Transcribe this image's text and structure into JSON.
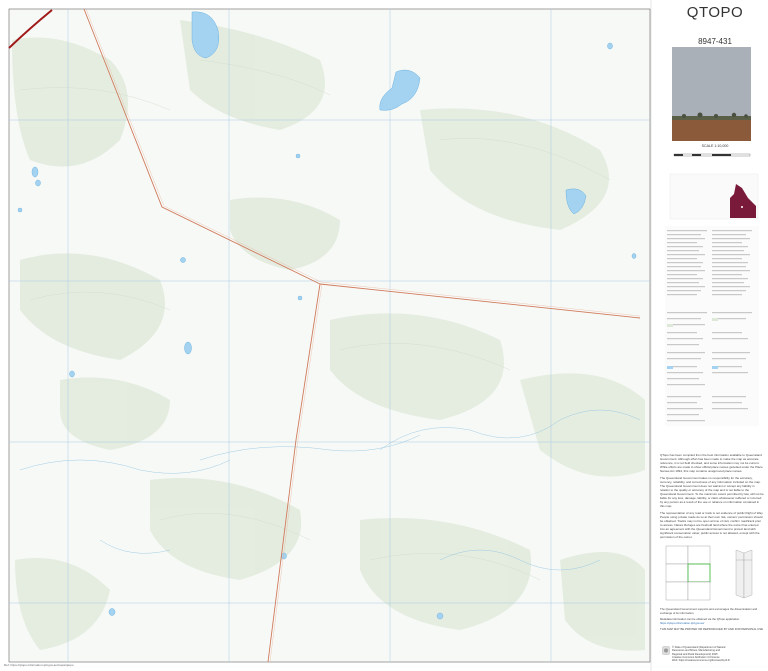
{
  "title": "QTOPO",
  "sheet_number": "8947-431",
  "scale_text": "SCALE 1:10,000",
  "disclaimer_paragraphs": [
    "QTopo has been compiled from the best information available to Queensland Government. Although effort has been made to make the map as accurate reference, it is not field checked, and some information may not be current. While efforts are made to show official place names gazetted under the Place Names Act 1994, this map contains unapproved place names.",
    "The Queensland Government takes no responsibility for the accuracy, currency, reliability, and correctness of any information included on the map. The Queensland Government does not warrant or accept any liability in relation to the quality or accuracy of the map and is not liable to the Queensland Government. To the maximum extent permitted by law, will not be liable for any loss, damage, liability, or claim whatsoever suffered or incurred by any person as a result of the use or reliance on information contained in this map.",
    "The representation of any road or track is not evidence of public Right of Way. People using private roads do so at their own risk, owners' permission should be obtained. Tracks may not be open at time of visit, confirm road/track prior to access. Nature Refuges are freehold land where the owner has entered into an agreement with the Queensland Government to protect land with significant conservation value; public access is not allowed, except with the permission of the owner."
  ],
  "support_note": "The Queensland Government supports and encourages the dissemination and exchange of its information.",
  "metadata_note": "Metadata information can be obtained via the QTopo application.",
  "metadata_link": "https://qtopo.information.qld.gov.au/",
  "not_for_sale": "THIS MAP MAY BE PRINTED OR REPRODUCED BY AND FOR PERSONAL USE",
  "copyright_lines": [
    "© State of Queensland (Department of Natural",
    "Resources and Mines, Manufacturing and",
    "Regional and Rural Development) 2025",
    "Creative Commons Attribution 4.0 licence",
    "Web: https://creativecommons.org/licenses/by/4.0/"
  ],
  "bottom_credit": "Ref: https://qtopo.information.qld.gov.au/maps/qtopo",
  "colors": {
    "background": "#f6f8f6",
    "vegetation": "#dde8d8",
    "water": "#9fd0f0",
    "road": "#c76a4b",
    "grid": "#9ec3e0",
    "boundary": "#a01a1a",
    "queensland": "#7a1a3a"
  }
}
